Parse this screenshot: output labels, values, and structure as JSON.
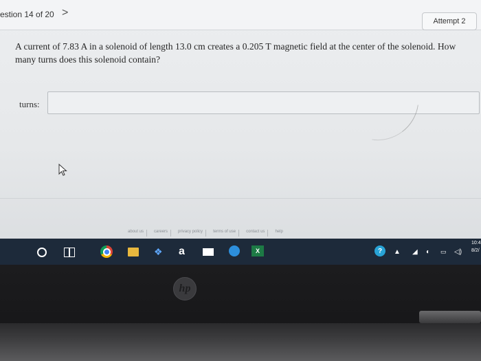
{
  "header": {
    "question_counter": "estion 14 of 20",
    "next_arrow": ">",
    "attempt_label": "Attempt 2"
  },
  "question": {
    "text": "A current of 7.83 A in a solenoid of length 13.0 cm creates a 0.205 T magnetic field at the center of the solenoid. How many turns does this solenoid contain?"
  },
  "answer": {
    "label": "turns:",
    "value": ""
  },
  "footer": {
    "links": [
      "about us",
      "careers",
      "privacy policy",
      "terms of use",
      "contact us",
      "help"
    ]
  },
  "taskbar": {
    "amazon_glyph": "a",
    "excel_glyph": "X",
    "help_glyph": "?",
    "clock_time": "10:4",
    "clock_date": "8/2/"
  },
  "colors": {
    "taskbar": "#1d2a3a",
    "screen_bg": "#eceef0",
    "bezel": "#1b1b1d"
  },
  "icons": [
    "search-icon",
    "task-view-icon",
    "chrome-icon",
    "file-explorer-icon",
    "dropbox-icon",
    "amazon-icon",
    "mail-icon",
    "edge-icon",
    "excel-icon",
    "help-icon",
    "chevron-up-icon",
    "network-icon",
    "volume-icon",
    "battery-icon",
    "hp-logo-icon"
  ]
}
